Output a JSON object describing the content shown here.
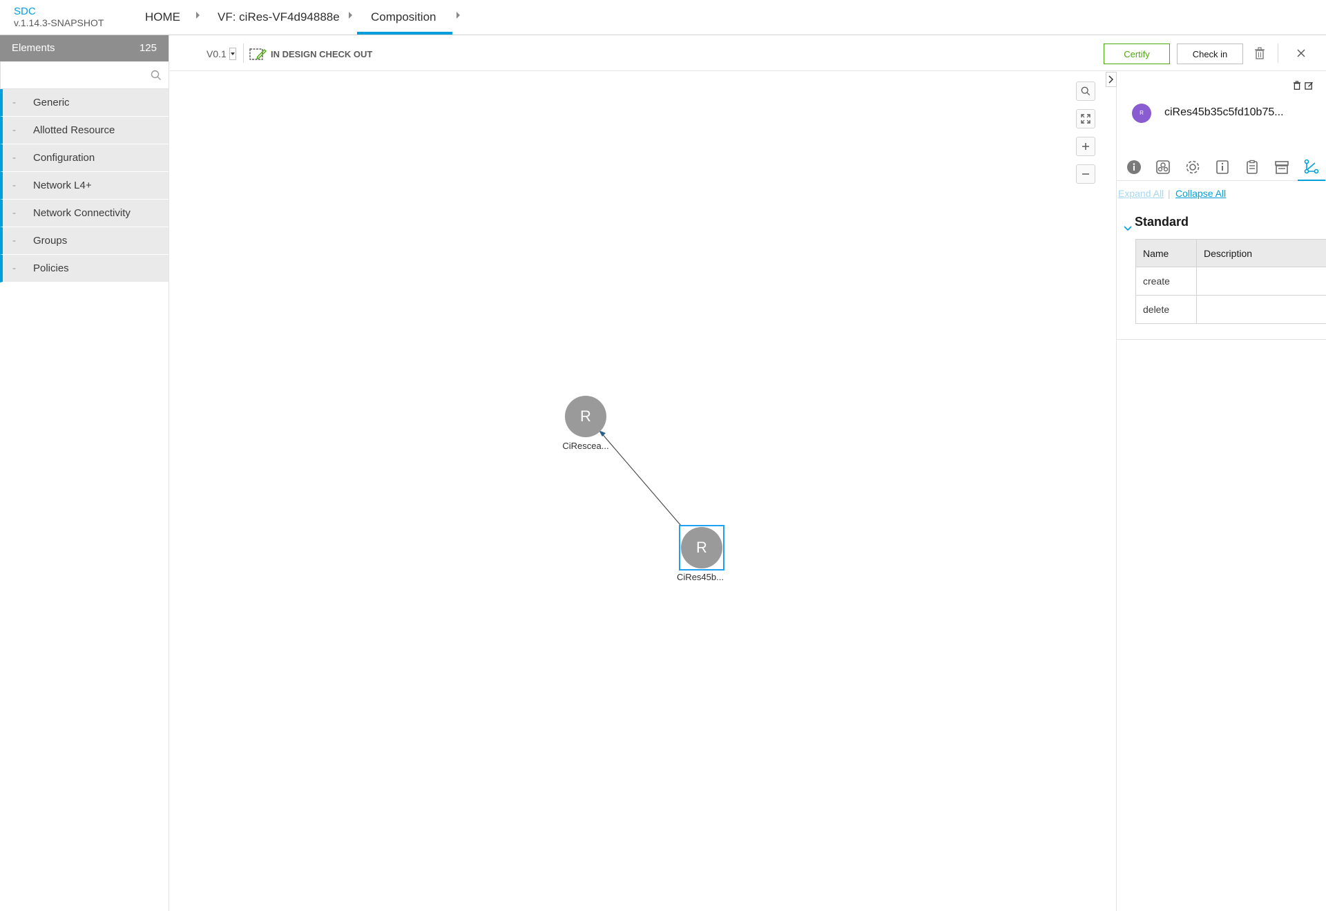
{
  "header": {
    "brand": "SDC",
    "version": "v.1.14.3-SNAPSHOT",
    "breadcrumbs": [
      "HOME",
      "VF: ciRes-VF4d94888e",
      "Composition"
    ]
  },
  "palette": {
    "title": "Elements",
    "count": "125",
    "search_placeholder": "",
    "items": [
      {
        "label": "Generic"
      },
      {
        "label": "Allotted Resource"
      },
      {
        "label": "Configuration"
      },
      {
        "label": "Network L4+"
      },
      {
        "label": "Network Connectivity"
      },
      {
        "label": "Groups"
      },
      {
        "label": "Policies"
      }
    ]
  },
  "toolbar": {
    "version": "V0.1",
    "status": "IN DESIGN CHECK OUT",
    "certify_label": "Certify",
    "checkin_label": "Check in"
  },
  "canvas": {
    "nodes": [
      {
        "letter": "R",
        "label": "CiRescea..."
      },
      {
        "letter": "R",
        "label": "CiRes45b..."
      }
    ]
  },
  "right_panel": {
    "avatar_letter": "R",
    "component_name": "ciRes45b35c5fd10b75...",
    "expand_all": "Expand All",
    "separator": "|",
    "collapse_all": "Collapse All",
    "section_title": "Standard",
    "table": {
      "headers": [
        "Name",
        "Description"
      ],
      "rows": [
        {
          "name": "create",
          "description": ""
        },
        {
          "name": "delete",
          "description": ""
        }
      ]
    }
  },
  "colors": {
    "accent": "#009fdb",
    "certify": "#4ca90c",
    "avatar": "#8a5cd1",
    "node": "#9a9a9a"
  }
}
